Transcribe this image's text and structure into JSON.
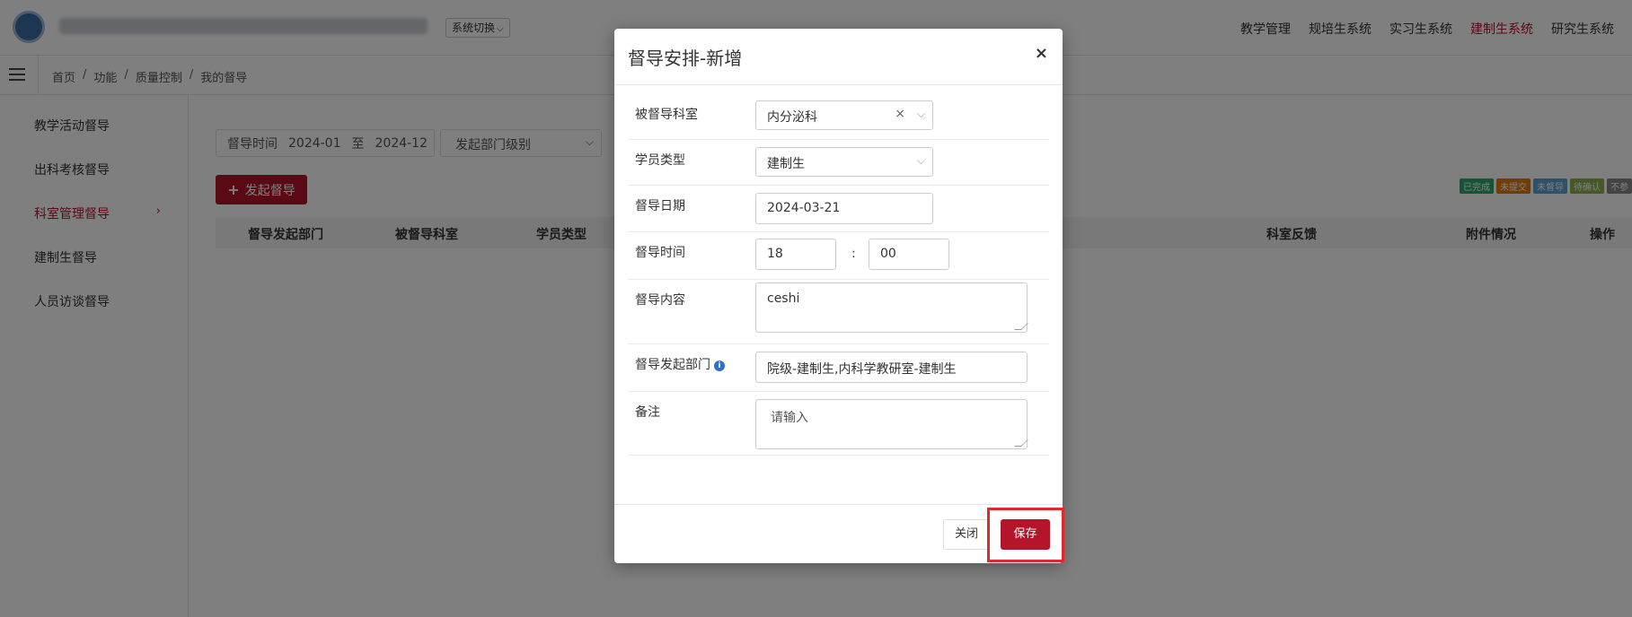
{
  "header": {
    "system_switch_label": "系统切换",
    "nav": [
      {
        "label": "教学管理",
        "active": false
      },
      {
        "label": "规培生系统",
        "active": false
      },
      {
        "label": "实习生系统",
        "active": false
      },
      {
        "label": "建制生系统",
        "active": true
      },
      {
        "label": "研究生系统",
        "active": false
      }
    ]
  },
  "breadcrumb": [
    "首页",
    "功能",
    "质量控制",
    "我的督导"
  ],
  "sidebar": {
    "items": [
      {
        "label": "教学活动督导"
      },
      {
        "label": "出科考核督导"
      },
      {
        "label": "科室管理督导",
        "active": true,
        "arrow": "›"
      },
      {
        "label": "建制生督导"
      },
      {
        "label": "人员访谈督导"
      }
    ]
  },
  "filters": {
    "date_label": "督导时间",
    "date_from": "2024-01",
    "date_sep": "至",
    "date_to": "2024-12",
    "dept_level_placeholder": "发起部门级别"
  },
  "add_button": {
    "icon": "plus-icon",
    "label": "发起督导"
  },
  "legend": [
    {
      "label": "已完成",
      "color": "#2ea86b"
    },
    {
      "label": "未提交",
      "color": "#e07b0c"
    },
    {
      "label": "未督导",
      "color": "#5aa0d6"
    },
    {
      "label": "待确认",
      "color": "#8cb04a"
    },
    {
      "label": "不参",
      "color": "#888888"
    }
  ],
  "table": {
    "columns": [
      "督导发起部门",
      "被督导科室",
      "学员类型",
      "科室反馈",
      "附件情况",
      "操作"
    ]
  },
  "modal": {
    "title": "督导安排-新增",
    "close_glyph": "×",
    "fields": {
      "dept_label": "被督导科室",
      "dept_value": "内分泌科",
      "dept_clear": "×",
      "student_type_label": "学员类型",
      "student_type_value": "建制生",
      "date_label": "督导日期",
      "date_value": "2024-03-21",
      "time_label": "督导时间",
      "time_hour": "18",
      "time_sep": ":",
      "time_minute": "00",
      "content_label": "督导内容",
      "content_value": "ceshi",
      "origin_dept_label": "督导发起部门",
      "origin_dept_value": "院级-建制生,内科学教研室-建制生",
      "remark_label": "备注",
      "remark_placeholder": "请输入"
    },
    "footer": {
      "close_label": "关闭",
      "save_label": "保存"
    }
  },
  "colors": {
    "brand": "#b5152b",
    "highlight": "#e0282e"
  }
}
